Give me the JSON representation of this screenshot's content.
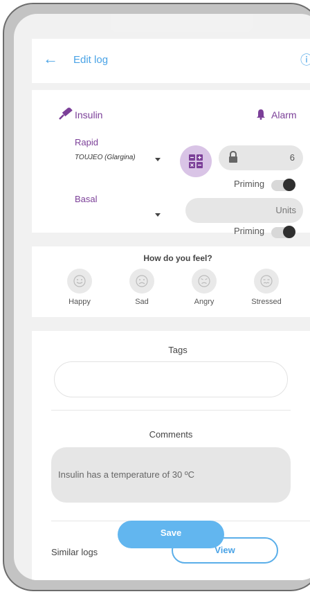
{
  "header": {
    "back_label": "←",
    "title": "Edit log",
    "info_label": "ⓘ"
  },
  "insulin": {
    "section_label": "Insulin",
    "alarm_label": "Alarm",
    "rapid_label": "Rapid",
    "rapid_value": "TOUJEO (Glargina)",
    "rapid_units": "6",
    "priming_label": "Priming",
    "basal_label": "Basal",
    "basal_value": "",
    "basal_units_placeholder": "Units",
    "priming_label_2": "Priming"
  },
  "feel": {
    "title": "How do you feel?",
    "moods": [
      {
        "label": "Happy"
      },
      {
        "label": "Sad"
      },
      {
        "label": "Angry"
      },
      {
        "label": "Stressed"
      }
    ]
  },
  "tags": {
    "label": "Tags",
    "value": ""
  },
  "comments": {
    "label": "Comments",
    "value": "Insulin has a temperature of 30 ºC"
  },
  "footer": {
    "similar_label": "Similar logs",
    "view_label": "View",
    "save_label": "Save"
  },
  "colors": {
    "accent_purple": "#7b3f98",
    "accent_blue": "#4aa3e6",
    "calculator_bg": "#d9c4e6"
  },
  "icons": [
    "back-arrow-icon",
    "info-icon",
    "syringe-icon",
    "bell-icon",
    "calculator-icon",
    "lock-icon",
    "chevron-down-icon",
    "happy-face-icon",
    "sad-face-icon",
    "angry-face-icon",
    "stressed-face-icon"
  ]
}
